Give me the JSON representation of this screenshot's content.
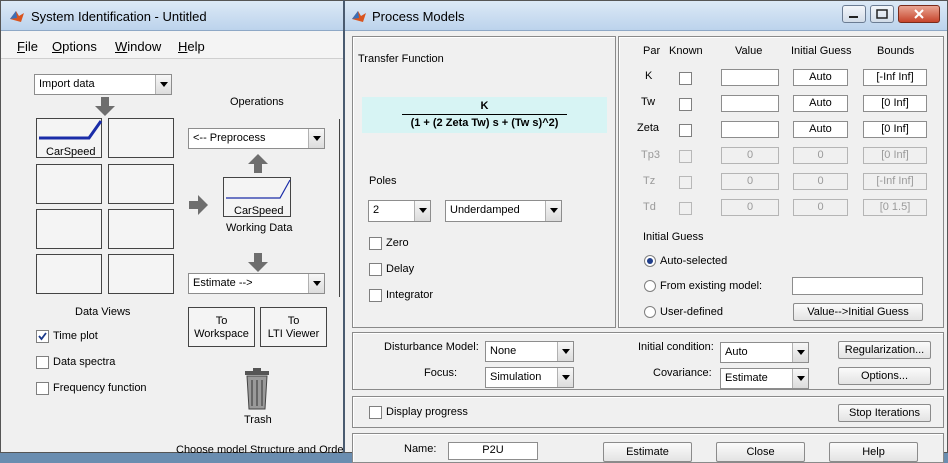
{
  "back_window": {
    "title": "System Identification - Untitled",
    "menu": [
      "File",
      "Options",
      "Window",
      "Help"
    ],
    "import_combo": "Import data",
    "operations_label": "Operations",
    "preprocess_combo": "<-- Preprocess",
    "data_slot_label": "CarSpeed",
    "working_data_label": "CarSpeed",
    "working_data_caption": "Working Data",
    "estimate_combo": "Estimate -->",
    "to_workspace": [
      "To",
      "Workspace"
    ],
    "to_lti_viewer": [
      "To",
      "LTI Viewer"
    ],
    "trash_label": "Trash",
    "data_views_label": "Data Views",
    "checkboxes": [
      {
        "label": "Time plot",
        "checked": true
      },
      {
        "label": "Data spectra",
        "checked": false
      },
      {
        "label": "Frequency function",
        "checked": false
      }
    ],
    "bottom_caption": "Choose model Structure and Orde"
  },
  "front_window": {
    "title": "Process Models",
    "transfer_function_label": "Transfer Function",
    "tf_numerator": "K",
    "tf_denominator": "(1 + (2 Zeta Tw) s + (Tw s)^2)",
    "poles_label": "Poles",
    "poles_value": "2",
    "damping_value": "Underdamped",
    "options": [
      "Zero",
      "Delay",
      "Integrator"
    ],
    "table_headers": [
      "Par",
      "Known",
      "Value",
      "Initial Guess",
      "Bounds"
    ],
    "params": [
      {
        "name": "K",
        "value": "",
        "guess": "Auto",
        "bounds": "[-Inf Inf]",
        "enabled": true
      },
      {
        "name": "Tw",
        "value": "",
        "guess": "Auto",
        "bounds": "[0 Inf]",
        "enabled": true
      },
      {
        "name": "Zeta",
        "value": "",
        "guess": "Auto",
        "bounds": "[0 Inf]",
        "enabled": true
      },
      {
        "name": "Tp3",
        "value": "0",
        "guess": "0",
        "bounds": "[0 Inf]",
        "enabled": false
      },
      {
        "name": "Tz",
        "value": "0",
        "guess": "0",
        "bounds": "[-Inf Inf]",
        "enabled": false
      },
      {
        "name": "Td",
        "value": "0",
        "guess": "0",
        "bounds": "[0 1.5]",
        "enabled": false
      }
    ],
    "initial_guess_label": "Initial Guess",
    "radio_auto": "Auto-selected",
    "radio_existing": "From existing model:",
    "radio_user": "User-defined",
    "value_to_guess_button": "Value-->Initial Guess",
    "disturbance_label": "Disturbance Model:",
    "disturbance_value": "None",
    "focus_label": "Focus:",
    "focus_value": "Simulation",
    "initial_condition_label": "Initial condition:",
    "initial_condition_value": "Auto",
    "covariance_label": "Covariance:",
    "covariance_value": "Estimate",
    "regularization_button": "Regularization...",
    "options_button": "Options...",
    "display_progress_label": "Display progress",
    "stop_iterations_button": "Stop Iterations",
    "name_label": "Name:",
    "name_value": "P2U",
    "estimate_button": "Estimate",
    "close_button": "Close",
    "help_button": "Help"
  }
}
